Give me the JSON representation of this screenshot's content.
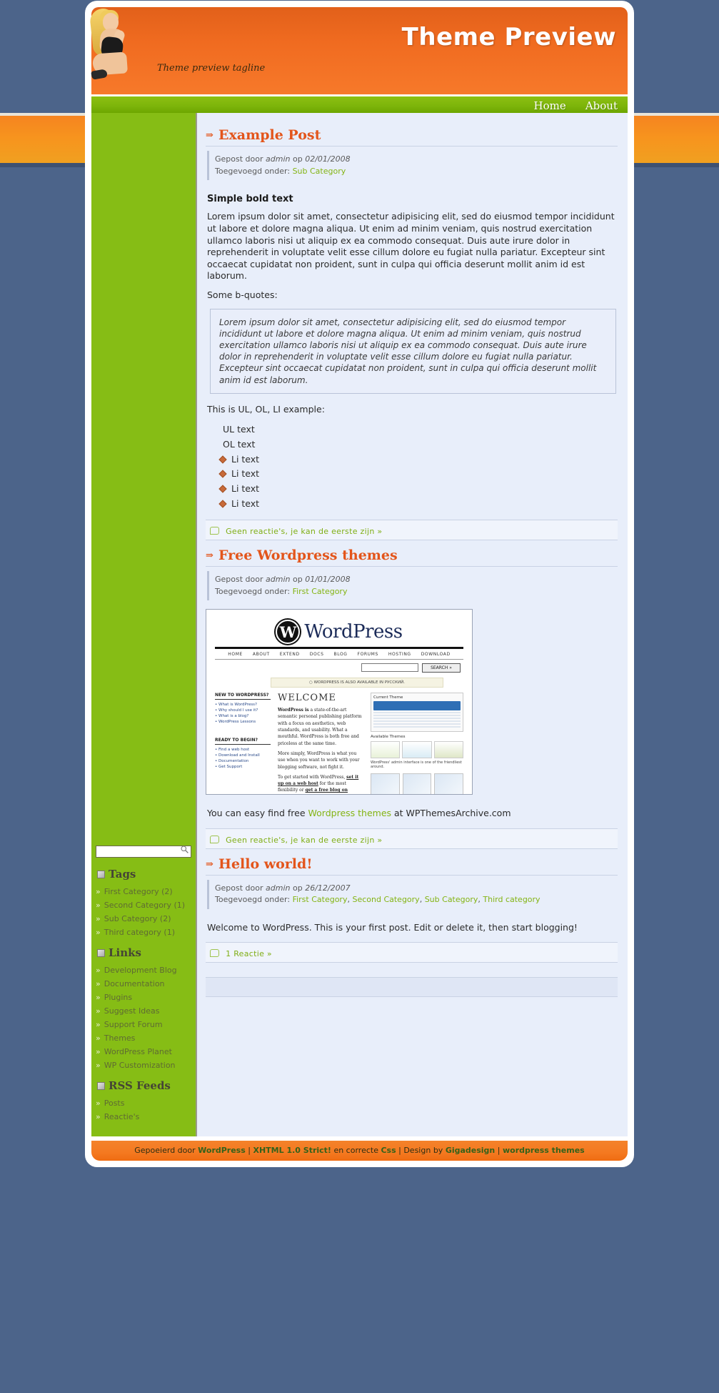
{
  "header": {
    "title": "Theme Preview",
    "tagline": "Theme preview tagline",
    "accent_orange": "#f47920",
    "accent_green": "#86bd15",
    "page_bg": "#4c648a"
  },
  "nav": {
    "items": [
      {
        "label": "Home"
      },
      {
        "label": "About"
      }
    ]
  },
  "posts": [
    {
      "title": "Example Post",
      "meta_author_prefix": "Gepost door",
      "author": "admin",
      "meta_date_prefix": "op",
      "date": "02/01/2008",
      "filed_prefix": "Toegevoegd onder:",
      "categories": [
        "Sub Category"
      ],
      "heading": "Simple bold text",
      "paragraph": "Lorem ipsum dolor sit amet, consectetur adipisicing elit, sed do eiusmod tempor incididunt ut labore et dolore magna aliqua. Ut enim ad minim veniam, quis nostrud exercitation ullamco laboris nisi ut aliquip ex ea commodo consequat. Duis aute irure dolor in reprehenderit in voluptate velit esse cillum dolore eu fugiat nulla pariatur. Excepteur sint occaecat cupidatat non proident, sunt in culpa qui officia deserunt mollit anim id est laborum.",
      "bquote_label": "Some b-quotes:",
      "bquote": "Lorem ipsum dolor sit amet, consectetur adipisicing elit, sed do eiusmod tempor incididunt ut labore et dolore magna aliqua. Ut enim ad minim veniam, quis nostrud exercitation ullamco laboris nisi ut aliquip ex ea commodo consequat. Duis aute irure dolor in reprehenderit in voluptate velit esse cillum dolore eu fugiat nulla pariatur. Excepteur sint occaecat cupidatat non proident, sunt in culpa qui officia deserunt mollit anim id est laborum.",
      "list_intro": "This is UL, OL, LI example:",
      "ul_text": "UL text",
      "ol_text": "OL text",
      "li_items": [
        "Li text",
        "Li text",
        "Li text",
        "Li text"
      ],
      "comment_link": "Geen reactie's, je kan de eerste zijn »"
    },
    {
      "title": "Free Wordpress themes",
      "meta_author_prefix": "Gepost door",
      "author": "admin",
      "meta_date_prefix": "op",
      "date": "01/01/2008",
      "filed_prefix": "Toegevoegd onder:",
      "categories": [
        "First Category"
      ],
      "caption_before": "You can easy find free ",
      "caption_link": "Wordpress themes",
      "caption_after": " at WPThemesArchive.com",
      "comment_link": "Geen reactie's, je kan de eerste zijn »"
    },
    {
      "title": "Hello world!",
      "meta_author_prefix": "Gepost door",
      "author": "admin",
      "meta_date_prefix": "op",
      "date": "26/12/2007",
      "filed_prefix": "Toegevoegd onder:",
      "categories": [
        "First Category",
        "Second Category",
        "Sub Category",
        "Third category"
      ],
      "paragraph": "Welcome to WordPress. This is your first post. Edit or delete it, then start blogging!",
      "comment_link": "1 Reactie »"
    }
  ],
  "wp_screenshot": {
    "brand": "WordPress",
    "brand_mark": "W",
    "nav": [
      "HOME",
      "ABOUT",
      "EXTEND",
      "DOCS",
      "BLOG",
      "FORUMS",
      "HOSTING",
      "DOWNLOAD"
    ],
    "search_button": "SEARCH »",
    "notice": "○ WORDPRESS IS ALSO AVAILABLE IN РУССКИЙ.",
    "col_left_h1": "NEW TO WORDPRESS?",
    "col_left_items1": [
      "What is WordPress?",
      "Why should I use it?",
      "What is a blog?",
      "WordPress Lessons"
    ],
    "col_left_h2": "READY TO BEGIN?",
    "col_left_items2": [
      "Find a web host",
      "Download and Install",
      "Documentation",
      "Get Support"
    ],
    "welcome": "WELCOME",
    "para1_bold": "WordPress is",
    "para1": " a state-of-the-art semantic personal publishing platform with a focus on aesthetics, web standards, and usability. What a mouthful. WordPress is both free and priceless at the same time.",
    "para2": "More simply, WordPress is what you use when you want to work with your blogging software, not fight it.",
    "para3_a": "To get started with WordPress, ",
    "para3_link1": "set it up on a web host",
    "para3_b": " for the most flexibility or ",
    "para3_link2": "get a free blog on WordPress.com",
    "para3_c": ".",
    "panel_h": "Current Theme",
    "panel_sub": "Available Themes",
    "panel_cap": "WordPress' admin interface is one of the friendliest around."
  },
  "sidebar": {
    "search_placeholder": "",
    "search_value": "",
    "sections": [
      {
        "title": "Tags",
        "items": [
          {
            "label": "First Category (2)"
          },
          {
            "label": "Second Category (1)"
          },
          {
            "label": "Sub Category (2)"
          },
          {
            "label": "Third category (1)"
          }
        ]
      },
      {
        "title": "Links",
        "items": [
          {
            "label": "Development Blog"
          },
          {
            "label": "Documentation"
          },
          {
            "label": "Plugins"
          },
          {
            "label": "Suggest Ideas"
          },
          {
            "label": "Support Forum"
          },
          {
            "label": "Themes"
          },
          {
            "label": "WordPress Planet"
          },
          {
            "label": "WP Customization"
          }
        ]
      },
      {
        "title": "RSS Feeds",
        "items": [
          {
            "label": "Posts"
          },
          {
            "label": "Reactie's"
          }
        ]
      }
    ]
  },
  "footer": {
    "t1": "Gepoeierd door ",
    "l1": "WordPress",
    "t2": " | ",
    "l2": "XHTML 1.0 Strict!",
    "t3": " en correcte ",
    "l3": "Css",
    "t4": " | Design by ",
    "l4": "Gigadesign",
    "t5": " | ",
    "l5": "wordpress themes"
  }
}
